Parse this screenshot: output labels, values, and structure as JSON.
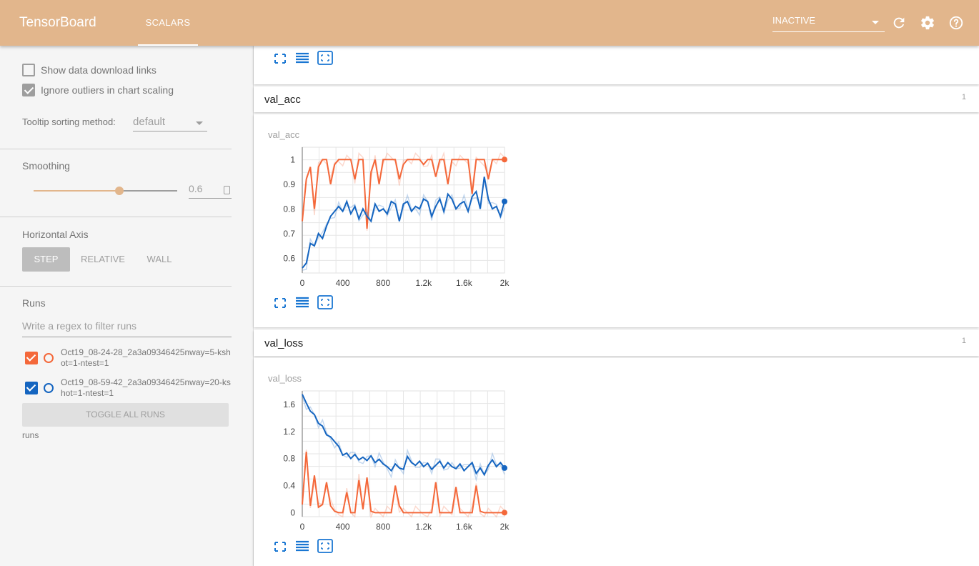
{
  "header": {
    "brand": "TensorBoard",
    "tab": "SCALARS",
    "run_status": "INACTIVE",
    "icons": [
      "refresh-icon",
      "settings-icon",
      "help-icon"
    ]
  },
  "sidebar": {
    "show_download_label": "Show data download links",
    "ignore_outliers_label": "Ignore outliers in chart scaling",
    "tooltip_label": "Tooltip sorting method:",
    "tooltip_value": "default",
    "smoothing_label": "Smoothing",
    "smoothing_value": "0.6",
    "horizontal_axis_label": "Horizontal Axis",
    "axis_options": [
      "STEP",
      "RELATIVE",
      "WALL"
    ],
    "runs_label": "Runs",
    "filter_placeholder": "Write a regex to filter runs",
    "runs": [
      {
        "name": "Oct19_08-24-28_2a3a09346425nway=5-kshot=1-ntest=1",
        "color": "#f4683a",
        "checked": true
      },
      {
        "name": "Oct19_08-59-42_2a3a09346425nway=20-kshot=1-ntest=1",
        "color": "#1565c0",
        "checked": true
      }
    ],
    "toggle_label": "TOGGLE ALL RUNS",
    "footer": "runs"
  },
  "categories": [
    {
      "title": "val_acc",
      "count": "1"
    },
    {
      "title": "val_loss",
      "count": "1"
    }
  ],
  "chart_data": [
    {
      "type": "line",
      "title": "val_acc",
      "xlim": [
        0,
        2000
      ],
      "ylim": [
        0.54,
        1.05
      ],
      "xticks": [
        "0",
        "400",
        "800",
        "1.2k",
        "1.6k",
        "2k"
      ],
      "yticks": [
        "0.6",
        "0.7",
        "0.8",
        "0.9",
        "1"
      ],
      "series": [
        {
          "color": "#f4683a",
          "x": [
            0,
            40,
            80,
            120,
            160,
            200,
            240,
            280,
            320,
            360,
            400,
            440,
            480,
            520,
            560,
            600,
            640,
            680,
            720,
            760,
            800,
            840,
            880,
            920,
            960,
            1000,
            1040,
            1080,
            1120,
            1160,
            1200,
            1240,
            1280,
            1320,
            1360,
            1400,
            1440,
            1480,
            1520,
            1560,
            1600,
            1640,
            1680,
            1720,
            1760,
            1800,
            1840,
            1880,
            1920,
            1960,
            2000
          ],
          "y": [
            0.75,
            0.92,
            0.97,
            0.8,
            0.97,
            1.0,
            1.0,
            0.9,
            0.98,
            1.0,
            1.0,
            1.0,
            1.0,
            0.92,
            1.0,
            1.0,
            0.72,
            0.95,
            1.0,
            0.9,
            1.0,
            1.0,
            1.0,
            1.0,
            0.92,
            0.98,
            1.0,
            1.0,
            1.0,
            1.0,
            0.98,
            1.0,
            1.0,
            0.93,
            1.0,
            1.0,
            0.9,
            1.0,
            1.0,
            1.0,
            1.0,
            1.0,
            0.86,
            1.0,
            1.0,
            1.0,
            0.92,
            1.0,
            1.0,
            1.0,
            1.0
          ]
        },
        {
          "color": "#1565c0",
          "x": [
            0,
            40,
            80,
            120,
            160,
            200,
            240,
            280,
            320,
            360,
            400,
            440,
            480,
            520,
            560,
            600,
            640,
            680,
            720,
            760,
            800,
            840,
            880,
            920,
            960,
            1000,
            1040,
            1080,
            1120,
            1160,
            1200,
            1240,
            1280,
            1320,
            1360,
            1400,
            1440,
            1480,
            1520,
            1560,
            1600,
            1640,
            1680,
            1720,
            1760,
            1800,
            1840,
            1880,
            1920,
            1960,
            2000
          ],
          "y": [
            0.56,
            0.58,
            0.66,
            0.65,
            0.7,
            0.68,
            0.73,
            0.77,
            0.79,
            0.81,
            0.79,
            0.83,
            0.78,
            0.81,
            0.76,
            0.8,
            0.77,
            0.75,
            0.82,
            0.79,
            0.8,
            0.78,
            0.83,
            0.82,
            0.75,
            0.82,
            0.83,
            0.79,
            0.81,
            0.8,
            0.84,
            0.83,
            0.77,
            0.81,
            0.84,
            0.79,
            0.86,
            0.84,
            0.8,
            0.82,
            0.83,
            0.79,
            0.85,
            0.87,
            0.8,
            0.93,
            0.84,
            0.8,
            0.81,
            0.77,
            0.83
          ]
        }
      ]
    },
    {
      "type": "line",
      "title": "val_loss",
      "xlim": [
        0,
        2000
      ],
      "ylim": [
        -0.06,
        1.8
      ],
      "xticks": [
        "0",
        "400",
        "800",
        "1.2k",
        "1.6k",
        "2k"
      ],
      "yticks": [
        "0",
        "0.4",
        "0.8",
        "1.2",
        "1.6"
      ],
      "series": [
        {
          "color": "#f4683a",
          "x": [
            0,
            40,
            80,
            120,
            160,
            200,
            240,
            280,
            320,
            360,
            400,
            440,
            480,
            520,
            560,
            600,
            640,
            680,
            720,
            760,
            800,
            840,
            880,
            920,
            960,
            1000,
            1040,
            1080,
            1120,
            1160,
            1200,
            1240,
            1280,
            1320,
            1360,
            1400,
            1440,
            1480,
            1520,
            1560,
            1600,
            1640,
            1680,
            1720,
            1760,
            1800,
            1840,
            1880,
            1920,
            1960,
            2000
          ],
          "y": [
            0.12,
            0.9,
            0.1,
            0.55,
            0.08,
            0.12,
            0.45,
            0.1,
            0.02,
            0.0,
            0.0,
            0.3,
            0.0,
            0.0,
            0.48,
            0.05,
            0.52,
            0.02,
            0.0,
            0.0,
            0.0,
            0.0,
            0.0,
            0.4,
            0.1,
            0.0,
            0.0,
            0.0,
            0.0,
            0.0,
            0.0,
            0.0,
            0.0,
            0.45,
            0.0,
            0.0,
            0.0,
            0.0,
            0.38,
            0.0,
            0.0,
            0.0,
            0.0,
            0.4,
            0.02,
            0.0,
            0.0,
            0.0,
            0.0,
            0.0,
            0.0
          ]
        },
        {
          "color": "#1565c0",
          "x": [
            0,
            40,
            80,
            120,
            160,
            200,
            240,
            280,
            320,
            360,
            400,
            440,
            480,
            520,
            560,
            600,
            640,
            680,
            720,
            760,
            800,
            840,
            880,
            920,
            960,
            1000,
            1040,
            1080,
            1120,
            1160,
            1200,
            1240,
            1280,
            1320,
            1360,
            1400,
            1440,
            1480,
            1520,
            1560,
            1600,
            1640,
            1680,
            1720,
            1760,
            1800,
            1840,
            1880,
            1920,
            1960,
            2000
          ],
          "y": [
            1.75,
            1.62,
            1.5,
            1.45,
            1.32,
            1.28,
            1.15,
            1.12,
            1.05,
            0.98,
            0.85,
            0.88,
            0.8,
            0.86,
            0.78,
            0.82,
            0.77,
            0.84,
            0.74,
            0.79,
            0.72,
            0.68,
            0.62,
            0.72,
            0.66,
            0.64,
            0.83,
            0.74,
            0.7,
            0.76,
            0.68,
            0.73,
            0.64,
            0.7,
            0.76,
            0.66,
            0.74,
            0.68,
            0.65,
            0.72,
            0.62,
            0.68,
            0.74,
            0.58,
            0.66,
            0.56,
            0.7,
            0.78,
            0.68,
            0.74,
            0.66
          ]
        }
      ]
    }
  ]
}
